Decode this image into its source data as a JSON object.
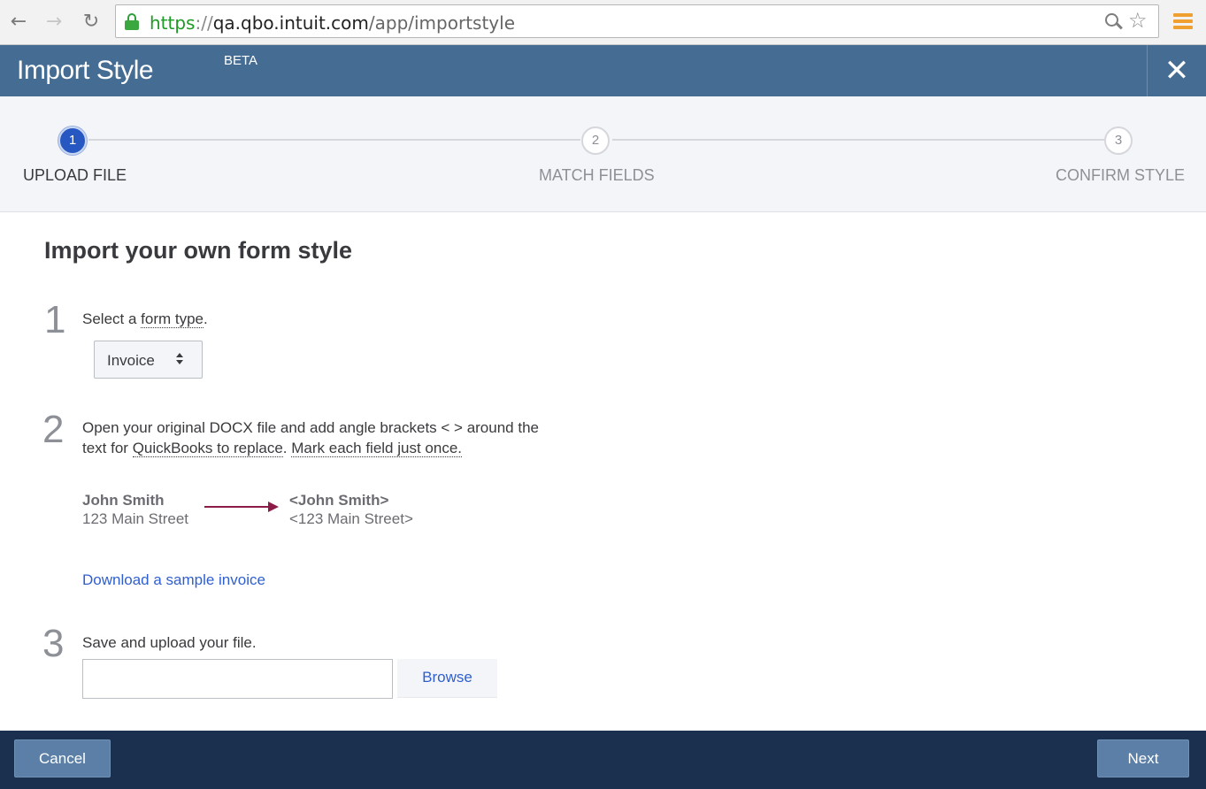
{
  "browser": {
    "url_scheme": "https",
    "url_sep": "://",
    "url_host": "qa.qbo.intuit.com",
    "url_path": "/app/importstyle",
    "icons": {
      "back": "back-arrow-icon",
      "forward": "forward-arrow-icon",
      "reload": "reload-icon",
      "lock": "lock-icon",
      "zoom": "zoom-icon",
      "star": "bookmark-star-icon",
      "menu": "menu-icon"
    }
  },
  "header": {
    "title": "Import Style",
    "beta": "BETA",
    "close_glyph": "✕"
  },
  "stepper": {
    "steps": [
      {
        "number": "1",
        "label": "UPLOAD FILE",
        "active": true
      },
      {
        "number": "2",
        "label": "MATCH FIELDS",
        "active": false
      },
      {
        "number": "3",
        "label": "CONFIRM STYLE",
        "active": false
      }
    ]
  },
  "main": {
    "title": "Import your own form style",
    "step1": {
      "number": "1",
      "text_prefix": "Select a ",
      "text_link": "form type",
      "text_suffix": ".",
      "select_value": "Invoice"
    },
    "step2": {
      "number": "2",
      "text_line1": "Open your original DOCX file and add angle brackets < > around the",
      "text_prefix2": "text for ",
      "text_link1": "QuickBooks to replace",
      "text_mid": ". ",
      "text_link2": "Mark each field just once.",
      "example_before_name": "John Smith",
      "example_before_address": "123 Main Street",
      "example_after_name": "<John Smith>",
      "example_after_address": "<123 Main Street>"
    },
    "download_link": "Download a sample invoice",
    "step3": {
      "number": "3",
      "text": "Save and upload your file.",
      "file_value": "",
      "browse_label": "Browse"
    }
  },
  "footer": {
    "cancel_label": "Cancel",
    "next_label": "Next"
  },
  "colors": {
    "header_bg": "#456c92",
    "footer_bg": "#1b2f4f",
    "active_step": "#2758c2",
    "link": "#2f5fcf",
    "arrow": "#8b1c48"
  }
}
